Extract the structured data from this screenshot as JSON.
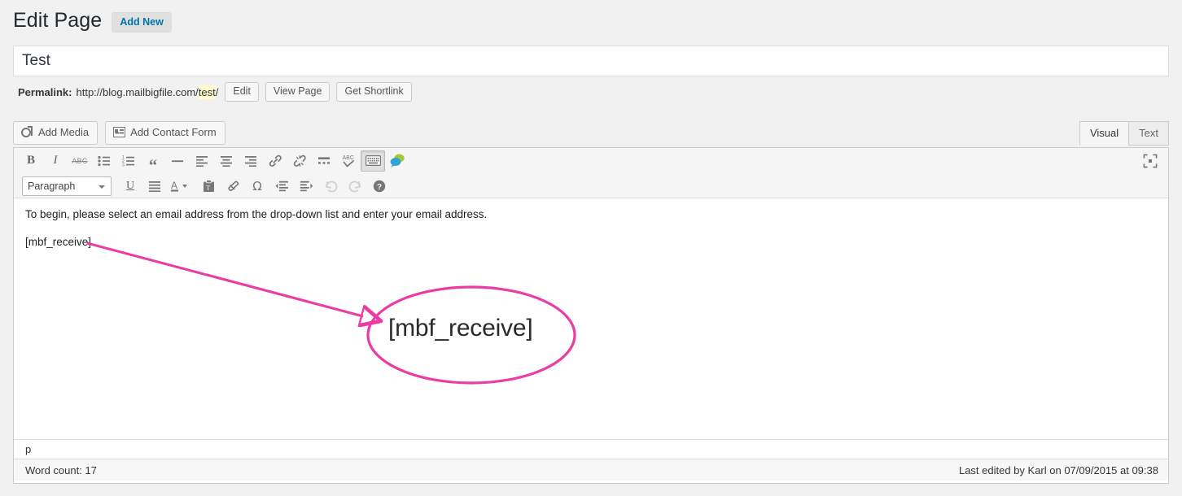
{
  "header": {
    "title": "Edit Page",
    "add_new_label": "Add New"
  },
  "title_field": {
    "value": "Test"
  },
  "permalink": {
    "label": "Permalink:",
    "url_prefix": "http://blog.mailbigfile.com/",
    "slug": "test",
    "url_suffix": "/",
    "buttons": {
      "edit": "Edit",
      "view_page": "View Page",
      "get_shortlink": "Get Shortlink"
    }
  },
  "media_bar": {
    "add_media": "Add Media",
    "add_contact_form": "Add Contact Form"
  },
  "editor_tabs": {
    "visual": "Visual",
    "text": "Text",
    "active": "Visual"
  },
  "toolbar": {
    "row1": [
      {
        "name": "bold-icon",
        "label": "B"
      },
      {
        "name": "italic-icon",
        "label": "I"
      },
      {
        "name": "strikethrough-icon",
        "label": "ABC"
      },
      {
        "name": "bullet-list-icon",
        "label": ""
      },
      {
        "name": "numbered-list-icon",
        "label": ""
      },
      {
        "name": "blockquote-icon",
        "label": "“"
      },
      {
        "name": "horizontal-rule-icon",
        "label": ""
      },
      {
        "name": "align-left-icon",
        "label": ""
      },
      {
        "name": "align-center-icon",
        "label": ""
      },
      {
        "name": "align-right-icon",
        "label": ""
      },
      {
        "name": "insert-link-icon",
        "label": ""
      },
      {
        "name": "unlink-icon",
        "label": ""
      },
      {
        "name": "insert-more-tag-icon",
        "label": ""
      },
      {
        "name": "spellcheck-icon",
        "label": "ABC"
      },
      {
        "name": "toggle-toolbar-icon",
        "label": ""
      },
      {
        "name": "comment-bubble-icon",
        "label": ""
      }
    ],
    "row2": [
      {
        "name": "underline-icon",
        "label": "U"
      },
      {
        "name": "justify-icon",
        "label": ""
      },
      {
        "name": "text-color-icon",
        "label": "A"
      },
      {
        "name": "paste-as-text-icon",
        "label": ""
      },
      {
        "name": "clear-formatting-icon",
        "label": ""
      },
      {
        "name": "special-character-icon",
        "label": "Ω"
      },
      {
        "name": "outdent-icon",
        "label": ""
      },
      {
        "name": "indent-icon",
        "label": ""
      },
      {
        "name": "undo-icon",
        "label": ""
      },
      {
        "name": "redo-icon",
        "label": ""
      },
      {
        "name": "help-icon",
        "label": "?"
      }
    ],
    "format_select": "Paragraph",
    "fullscreen_icon": "fullscreen-icon"
  },
  "content": {
    "paragraph_1": "To begin, please select an email address from the drop-down list and enter your email address.",
    "paragraph_2": "[mbf_receive]"
  },
  "annotation": {
    "callout_text": "[mbf_receive]",
    "color": "#EA3CA2"
  },
  "path_bar": {
    "path": "p"
  },
  "status_bar": {
    "word_count": "Word count: 17",
    "last_edited": "Last edited by Karl on 07/09/2015 at 09:38"
  }
}
